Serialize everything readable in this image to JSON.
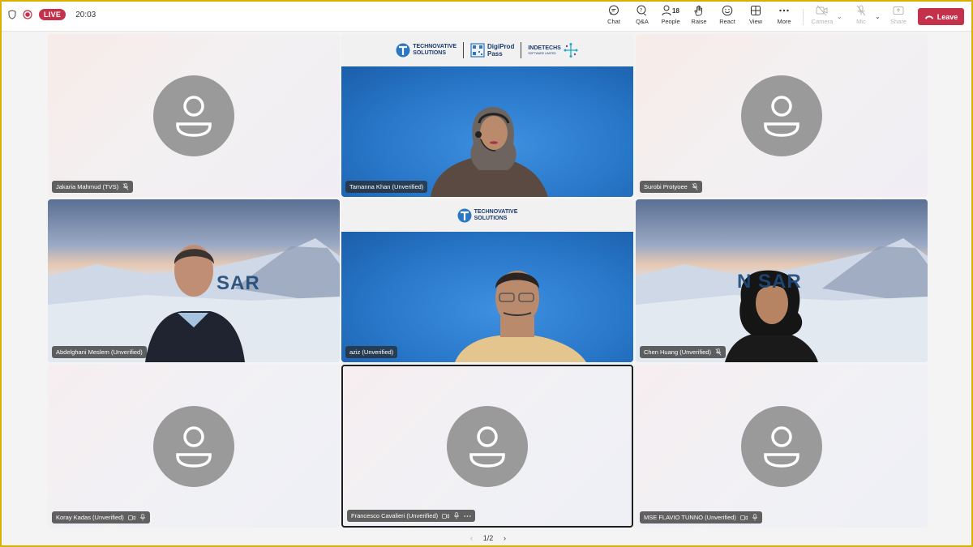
{
  "topbar": {
    "live_label": "LIVE",
    "timer": "20:03",
    "buttons": {
      "chat": "Chat",
      "qa": "Q&A",
      "people": "People",
      "people_count": "18",
      "raise": "Raise",
      "react": "React",
      "view": "View",
      "more": "More",
      "camera": "Camera",
      "mic": "Mic",
      "share": "Share"
    },
    "leave": "Leave"
  },
  "tiles": [
    {
      "name": "Jakaria Mahmud (TVS)"
    },
    {
      "name": "Tamanna Khan (Unverified)"
    },
    {
      "name": "Surobi Protyoee"
    },
    {
      "name": "Abdelghani Meslem (Unverified)"
    },
    {
      "name": "aziz (Unverified)"
    },
    {
      "name": "Chen Huang (Unverified)"
    },
    {
      "name": "Koray Kadas (Unverified)"
    },
    {
      "name": "Francesco Cavalieri (Unverified)"
    },
    {
      "name": "MSE FLAVIO TUNNO (Unverified)"
    }
  ],
  "logos": {
    "company_line1": "TECHNOVATIVE",
    "company_line2": "SOLUTIONS",
    "product_line1": "DigiProd",
    "product_line2": "Pass",
    "partner": "INDETECHS",
    "partner_sub": "SOFTWARE LIMITED",
    "overlay_brand": "SAR",
    "overlay_brand2": "N    SAR"
  },
  "pager": {
    "label": "1/2"
  },
  "colors": {
    "leave": "#c4314b",
    "live": "#c4314b",
    "avatar": "#9a9a9a"
  }
}
